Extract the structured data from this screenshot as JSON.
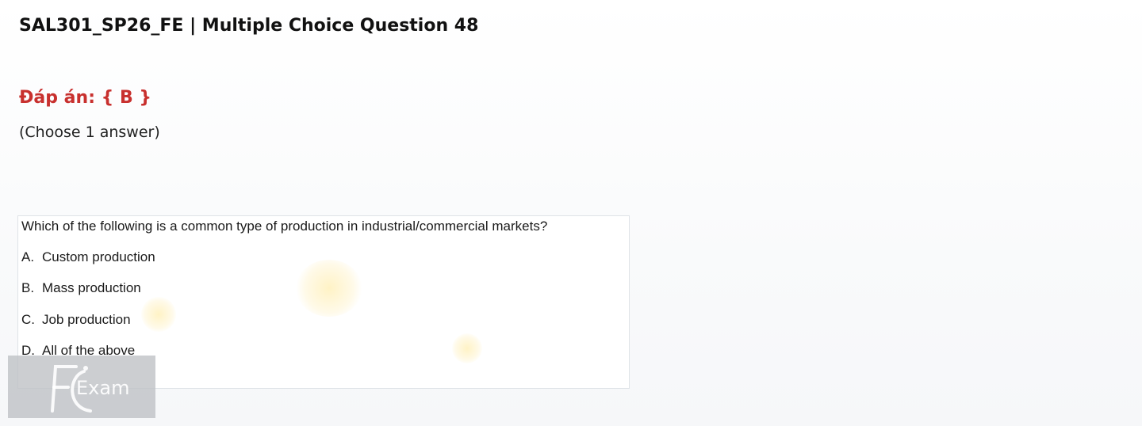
{
  "page": {
    "title": "SAL301_SP26_FE | Multiple Choice Question 48",
    "answer_label": "Đáp án: { B }",
    "choose_hint": "(Choose 1 answer)"
  },
  "question": {
    "text": "Which of the following is a common type of production in industrial/commercial markets?",
    "options": [
      {
        "letter": "A.",
        "text": "Custom production"
      },
      {
        "letter": "B.",
        "text": "Mass production"
      },
      {
        "letter": "C.",
        "text": "Job production"
      },
      {
        "letter": "D.",
        "text": "All of the above"
      }
    ]
  },
  "watermark": {
    "logo_text": "Exam"
  },
  "colors": {
    "answer": "#c8302e",
    "title": "#111111",
    "box_border": "#dfe3e7"
  }
}
